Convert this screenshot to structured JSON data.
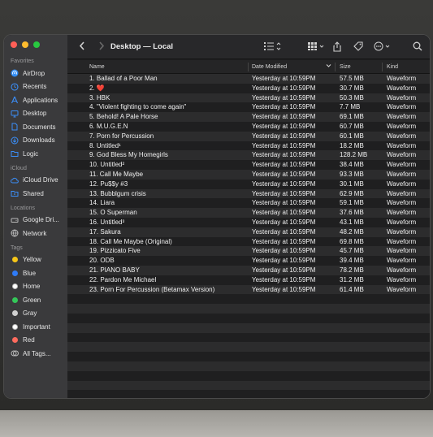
{
  "window": {
    "title": "Desktop — Local"
  },
  "sidebar": {
    "sections": [
      {
        "title": "Favorites",
        "items": [
          {
            "label": "AirDrop",
            "icon": "airdrop-icon"
          },
          {
            "label": "Recents",
            "icon": "clock-icon"
          },
          {
            "label": "Applications",
            "icon": "applications-icon"
          },
          {
            "label": "Desktop",
            "icon": "desktop-icon"
          },
          {
            "label": "Documents",
            "icon": "document-icon"
          },
          {
            "label": "Downloads",
            "icon": "download-icon"
          },
          {
            "label": "Logic",
            "icon": "folder-icon"
          }
        ]
      },
      {
        "title": "iCloud",
        "items": [
          {
            "label": "iCloud Drive",
            "icon": "cloud-icon"
          },
          {
            "label": "Shared",
            "icon": "shared-folder-icon"
          }
        ]
      },
      {
        "title": "Locations",
        "items": [
          {
            "label": "Google Dri...",
            "icon": "drive-icon"
          },
          {
            "label": "Network",
            "icon": "globe-icon"
          }
        ]
      },
      {
        "title": "Tags",
        "items": [
          {
            "label": "Yellow",
            "color": "#f5c518"
          },
          {
            "label": "Blue",
            "color": "#2f7bf6"
          },
          {
            "label": "Home",
            "color": "#ffffff"
          },
          {
            "label": "Green",
            "color": "#34c759"
          },
          {
            "label": "Gray",
            "color": "#d0d0d0"
          },
          {
            "label": "Important",
            "color": "#ffffff"
          },
          {
            "label": "Red",
            "color": "#ff6b5e"
          },
          {
            "label": "All Tags...",
            "icon": "all-tags-icon"
          }
        ]
      }
    ]
  },
  "columns": {
    "name": "Name",
    "date": "Date Modified",
    "size": "Size",
    "kind": "Kind"
  },
  "files": [
    {
      "name": "1. Ballad of a Poor Man",
      "date": "Yesterday at 10:59PM",
      "size": "57.5 MB",
      "kind": "Waveform"
    },
    {
      "name": "2. ❤️",
      "date": "Yesterday at 10:59PM",
      "size": "30.7 MB",
      "kind": "Waveform"
    },
    {
      "name": "3. HBK",
      "date": "Yesterday at 10:59PM",
      "size": "50.3 MB",
      "kind": "Waveform"
    },
    {
      "name": "4. \"Violent fighting to come again\"",
      "date": "Yesterday at 10:59PM",
      "size": "7.7 MB",
      "kind": "Waveform"
    },
    {
      "name": "5. Behold! A Pale Horse",
      "date": "Yesterday at 10:59PM",
      "size": "69.1 MB",
      "kind": "Waveform"
    },
    {
      "name": "6. M.U.G.E.N",
      "date": "Yesterday at 10:59PM",
      "size": "60.7 MB",
      "kind": "Waveform"
    },
    {
      "name": "7. Porn for Percussion",
      "date": "Yesterday at 10:59PM",
      "size": "60.1 MB",
      "kind": "Waveform"
    },
    {
      "name": "8. Untitled¹",
      "date": "Yesterday at 10:59PM",
      "size": "18.2 MB",
      "kind": "Waveform"
    },
    {
      "name": "9. God Bless My Homegirls",
      "date": "Yesterday at 10:59PM",
      "size": "128.2 MB",
      "kind": "Waveform"
    },
    {
      "name": "10. Untitled²",
      "date": "Yesterday at 10:59PM",
      "size": "38.4 MB",
      "kind": "Waveform"
    },
    {
      "name": "11. Call Me Maybe",
      "date": "Yesterday at 10:59PM",
      "size": "93.3 MB",
      "kind": "Waveform"
    },
    {
      "name": "12. Pu$$y #3",
      "date": "Yesterday at 10:59PM",
      "size": "30.1 MB",
      "kind": "Waveform"
    },
    {
      "name": "13. Bubblgum crisis",
      "date": "Yesterday at 10:59PM",
      "size": "62.9 MB",
      "kind": "Waveform"
    },
    {
      "name": "14. Liara",
      "date": "Yesterday at 10:59PM",
      "size": "59.1 MB",
      "kind": "Waveform"
    },
    {
      "name": "15. O Superman",
      "date": "Yesterday at 10:59PM",
      "size": "37.6 MB",
      "kind": "Waveform"
    },
    {
      "name": "16. Untitled³",
      "date": "Yesterday at 10:59PM",
      "size": "43.1 MB",
      "kind": "Waveform"
    },
    {
      "name": "17. Sakura",
      "date": "Yesterday at 10:59PM",
      "size": "48.2 MB",
      "kind": "Waveform"
    },
    {
      "name": "18. Call Me Maybe (Original)",
      "date": "Yesterday at 10:59PM",
      "size": "69.8 MB",
      "kind": "Waveform"
    },
    {
      "name": "19. Pizzicato Five",
      "date": "Yesterday at 10:59PM",
      "size": "45.7 MB",
      "kind": "Waveform"
    },
    {
      "name": "20. ODB",
      "date": "Yesterday at 10:59PM",
      "size": "39.4 MB",
      "kind": "Waveform"
    },
    {
      "name": "21. PIANO BABY",
      "date": "Yesterday at 10:59PM",
      "size": "78.2 MB",
      "kind": "Waveform"
    },
    {
      "name": "22. Pardon Me Michael",
      "date": "Yesterday at 10:59PM",
      "size": "31.2 MB",
      "kind": "Waveform"
    },
    {
      "name": "23. Porn For Percussion (Betamax Version)",
      "date": "Yesterday at 10:59PM",
      "size": "61.4 MB",
      "kind": "Waveform"
    }
  ]
}
